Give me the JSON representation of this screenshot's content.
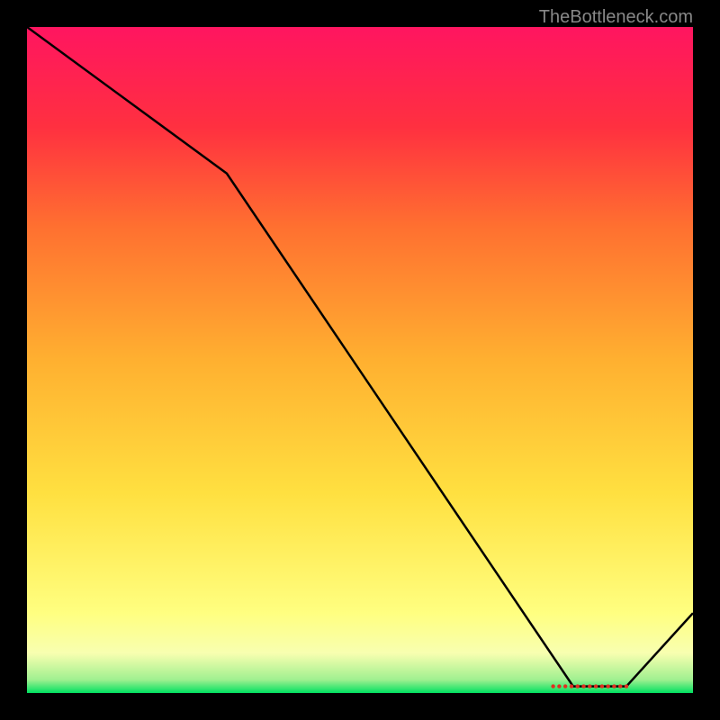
{
  "watermark": "TheBottleneck.com",
  "chart_data": {
    "type": "line",
    "title": "",
    "xlabel": "",
    "ylabel": "",
    "xlim": [
      0,
      100
    ],
    "ylim": [
      0,
      100
    ],
    "x": [
      0,
      30,
      82,
      90,
      100
    ],
    "y": [
      100,
      78,
      1,
      1,
      12
    ],
    "flat_segment_x": [
      79,
      90
    ],
    "flat_segment_y": 1,
    "gradient_stops": [
      {
        "offset": 0,
        "color": "#00e060"
      },
      {
        "offset": 2,
        "color": "#a0f090"
      },
      {
        "offset": 6,
        "color": "#f8ffb0"
      },
      {
        "offset": 12,
        "color": "#ffff80"
      },
      {
        "offset": 30,
        "color": "#ffe040"
      },
      {
        "offset": 50,
        "color": "#ffb030"
      },
      {
        "offset": 70,
        "color": "#ff7030"
      },
      {
        "offset": 85,
        "color": "#ff3040"
      },
      {
        "offset": 100,
        "color": "#ff1560"
      }
    ]
  }
}
